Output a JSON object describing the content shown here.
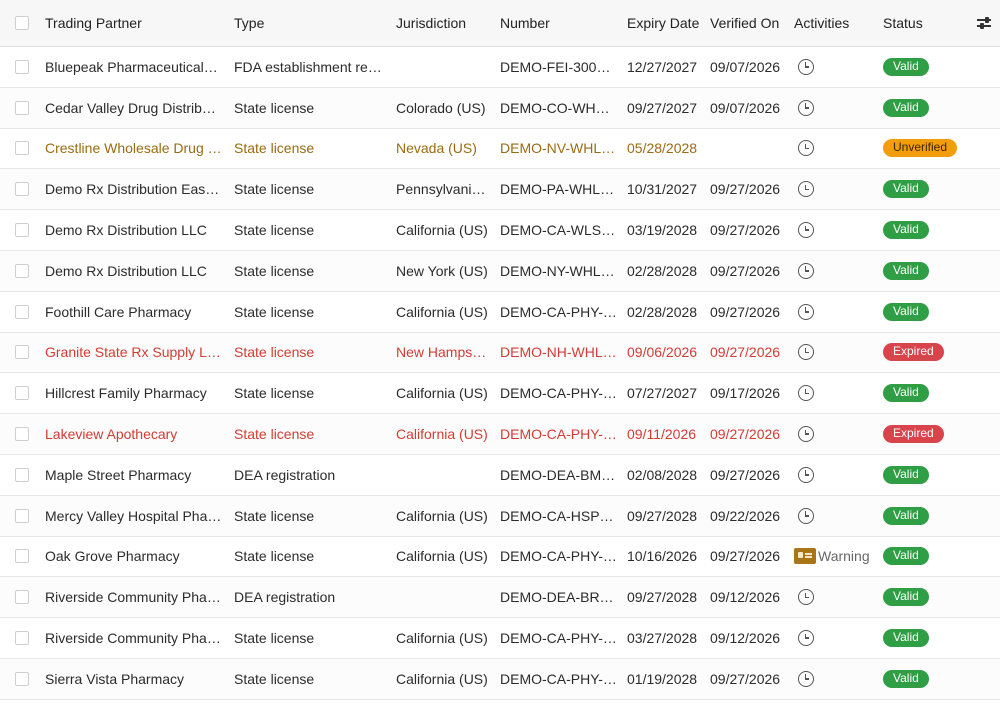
{
  "columns": {
    "trading_partner": "Trading Partner",
    "type": "Type",
    "jurisdiction": "Jurisdiction",
    "number": "Number",
    "expiry_date": "Expiry Date",
    "verified_on": "Verified On",
    "activities": "Activities",
    "status": "Status"
  },
  "icons": {
    "settings": "sliders-icon",
    "activity": "clock-icon",
    "warning": "id-card-icon"
  },
  "colors": {
    "valid": "#2f9e44",
    "unverified": "#f29d0c",
    "expired": "#d9434c",
    "warning_text": "#9a6b12",
    "error_text": "#d23c34"
  },
  "rows": [
    {
      "partner": "Bluepeak Pharmaceutical…",
      "type": "FDA establishment re…",
      "jurisdiction": "",
      "number": "DEMO-FEI-300…",
      "expiry": "12/27/2027",
      "verified": "09/07/2026",
      "activity": "",
      "status": "Valid"
    },
    {
      "partner": "Cedar Valley Drug Distribu…",
      "type": "State license",
      "jurisdiction": "Colorado (US)",
      "number": "DEMO-CO-WH…",
      "expiry": "09/27/2027",
      "verified": "09/07/2026",
      "activity": "",
      "status": "Valid"
    },
    {
      "partner": "Crestline Wholesale Drug …",
      "type": "State license",
      "jurisdiction": "Nevada (US)",
      "number": "DEMO-NV-WHL…",
      "expiry": "05/28/2028",
      "verified": "",
      "activity": "",
      "status": "Unverified"
    },
    {
      "partner": "Demo Rx Distribution East…",
      "type": "State license",
      "jurisdiction": "Pennsylvani…",
      "number": "DEMO-PA-WHL…",
      "expiry": "10/31/2027",
      "verified": "09/27/2026",
      "activity": "",
      "status": "Valid"
    },
    {
      "partner": "Demo Rx Distribution LLC",
      "type": "State license",
      "jurisdiction": "California (US)",
      "number": "DEMO-CA-WLS…",
      "expiry": "03/19/2028",
      "verified": "09/27/2026",
      "activity": "",
      "status": "Valid"
    },
    {
      "partner": "Demo Rx Distribution LLC",
      "type": "State license",
      "jurisdiction": "New York (US)",
      "number": "DEMO-NY-WHL…",
      "expiry": "02/28/2028",
      "verified": "09/27/2026",
      "activity": "",
      "status": "Valid"
    },
    {
      "partner": "Foothill Care Pharmacy",
      "type": "State license",
      "jurisdiction": "California (US)",
      "number": "DEMO-CA-PHY-…",
      "expiry": "02/28/2028",
      "verified": "09/27/2026",
      "activity": "",
      "status": "Valid"
    },
    {
      "partner": "Granite State Rx Supply L…",
      "type": "State license",
      "jurisdiction": "New Hamps…",
      "number": "DEMO-NH-WHL…",
      "expiry": "09/06/2026",
      "verified": "09/27/2026",
      "activity": "",
      "status": "Expired"
    },
    {
      "partner": "Hillcrest Family Pharmacy",
      "type": "State license",
      "jurisdiction": "California (US)",
      "number": "DEMO-CA-PHY-…",
      "expiry": "07/27/2027",
      "verified": "09/17/2026",
      "activity": "",
      "status": "Valid"
    },
    {
      "partner": "Lakeview Apothecary",
      "type": "State license",
      "jurisdiction": "California (US)",
      "number": "DEMO-CA-PHY-…",
      "expiry": "09/11/2026",
      "verified": "09/27/2026",
      "activity": "",
      "status": "Expired"
    },
    {
      "partner": "Maple Street Pharmacy",
      "type": "DEA registration",
      "jurisdiction": "",
      "number": "DEMO-DEA-BM…",
      "expiry": "02/08/2028",
      "verified": "09/27/2026",
      "activity": "",
      "status": "Valid"
    },
    {
      "partner": "Mercy Valley Hospital Pha…",
      "type": "State license",
      "jurisdiction": "California (US)",
      "number": "DEMO-CA-HSP…",
      "expiry": "09/27/2028",
      "verified": "09/22/2026",
      "activity": "",
      "status": "Valid"
    },
    {
      "partner": "Oak Grove Pharmacy",
      "type": "State license",
      "jurisdiction": "California (US)",
      "number": "DEMO-CA-PHY-…",
      "expiry": "10/16/2026",
      "verified": "09/27/2026",
      "activity": "Warning",
      "status": "Valid"
    },
    {
      "partner": "Riverside Community Pha…",
      "type": "DEA registration",
      "jurisdiction": "",
      "number": "DEMO-DEA-BR…",
      "expiry": "09/27/2028",
      "verified": "09/12/2026",
      "activity": "",
      "status": "Valid"
    },
    {
      "partner": "Riverside Community Pha…",
      "type": "State license",
      "jurisdiction": "California (US)",
      "number": "DEMO-CA-PHY-…",
      "expiry": "03/27/2028",
      "verified": "09/12/2026",
      "activity": "",
      "status": "Valid"
    },
    {
      "partner": "Sierra Vista Pharmacy",
      "type": "State license",
      "jurisdiction": "California (US)",
      "number": "DEMO-CA-PHY-…",
      "expiry": "01/19/2028",
      "verified": "09/27/2026",
      "activity": "",
      "status": "Valid"
    }
  ]
}
